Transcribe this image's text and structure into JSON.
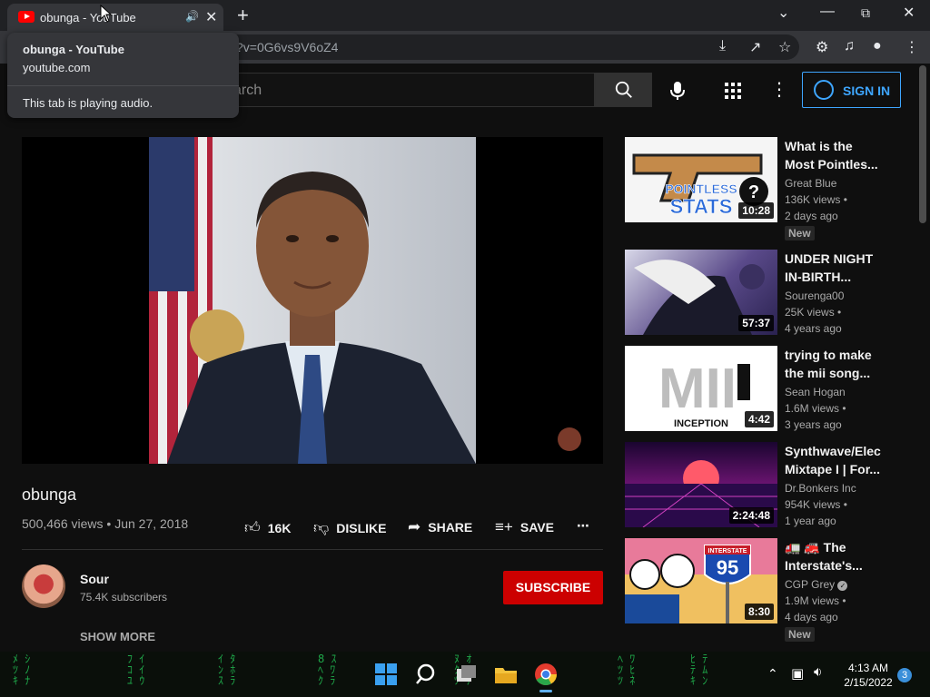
{
  "browser": {
    "tab_title": "obunga - YouTube",
    "url_partial": "?v=0G6vs9V6oZ4",
    "tooltip": {
      "title": "obunga - YouTube",
      "domain": "youtube.com",
      "status": "This tab is playing audio."
    }
  },
  "youtube": {
    "search_placeholder": "arch",
    "sign_in_label": "SIGN IN"
  },
  "video": {
    "title": "obunga",
    "views": "500,466 views",
    "date": "Jun 27, 2018",
    "likes": "16K",
    "dislike_label": "DISLIKE",
    "share_label": "SHARE",
    "save_label": "SAVE"
  },
  "channel": {
    "name": "Sour",
    "subscribers": "75.4K subscribers",
    "subscribe_label": "SUBSCRIBE",
    "show_more_label": "SHOW MORE"
  },
  "recommendations": [
    {
      "title_line1": "What is the",
      "title_line2": "Most Pointles...",
      "channel": "Great Blue",
      "views": "136K views •",
      "ago": "2 days ago",
      "duration": "10:28",
      "badge": "New"
    },
    {
      "title_line1": "UNDER NIGHT",
      "title_line2": "IN-BIRTH...",
      "channel": "Sourenga00",
      "views": "25K views •",
      "ago": "4 years ago",
      "duration": "57:37",
      "badge": ""
    },
    {
      "title_line1": "trying to make",
      "title_line2": "the mii song...",
      "channel": "Sean Hogan",
      "views": "1.6M views •",
      "ago": "3 years ago",
      "duration": "4:42",
      "badge": ""
    },
    {
      "title_line1": "Synthwave/Elec",
      "title_line2": "Mixtape I | For...",
      "channel": "Dr.Bonkers Inc",
      "views": "954K views •",
      "ago": "1 year ago",
      "duration": "2:24:48",
      "badge": ""
    },
    {
      "title_line1": "🚛 🚒 The",
      "title_line2": "Interstate's...",
      "channel": "CGP Grey",
      "views": "1.9M views •",
      "ago": "4 days ago",
      "duration": "8:30",
      "badge": "New"
    }
  ],
  "thumb_text": {
    "pointless": "POINTLESS",
    "stats": "STATS",
    "inception": "INCEPTION",
    "interstate": "INTERSTATE",
    "route": "95"
  },
  "taskbar": {
    "time": "4:13 AM",
    "date": "2/15/2022",
    "notifications": "3"
  },
  "colors": {
    "accent_blue": "#3ea6ff",
    "subscribe_red": "#cc0000",
    "background": "#0f0f0f"
  }
}
